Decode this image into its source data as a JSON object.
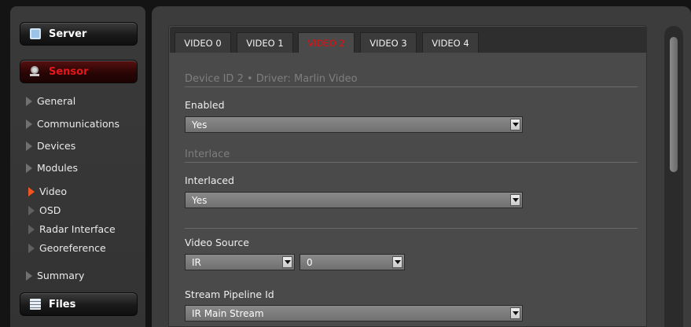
{
  "sidebar": {
    "server_label": "Server",
    "sensor_label": "Sensor",
    "files_label": "Files",
    "items": [
      {
        "label": "General"
      },
      {
        "label": "Communications"
      },
      {
        "label": "Devices"
      },
      {
        "label": "Modules"
      }
    ],
    "subitems": [
      {
        "label": "Video"
      },
      {
        "label": "OSD"
      },
      {
        "label": "Radar Interface"
      },
      {
        "label": "Georeference"
      }
    ],
    "summary_label": "Summary"
  },
  "tabs": [
    {
      "label": "VIDEO 0"
    },
    {
      "label": "VIDEO 1"
    },
    {
      "label": "VIDEO 2"
    },
    {
      "label": "VIDEO 3"
    },
    {
      "label": "VIDEO 4"
    }
  ],
  "active_tab": "VIDEO 2",
  "form": {
    "device_header": "Device ID 2  •  Driver: Marlin Video",
    "enabled_label": "Enabled",
    "enabled_value": "Yes",
    "interlace_header": "Interlace",
    "interlaced_label": "Interlaced",
    "interlaced_value": "Yes",
    "video_source_label": "Video Source",
    "video_source_value": "IR",
    "video_source_index": "0",
    "stream_pipeline_label": "Stream Pipeline Id",
    "stream_pipeline_value": "IR Main Stream"
  },
  "colors": {
    "accent_red": "#e21010",
    "active_nav": "#ee5522"
  }
}
